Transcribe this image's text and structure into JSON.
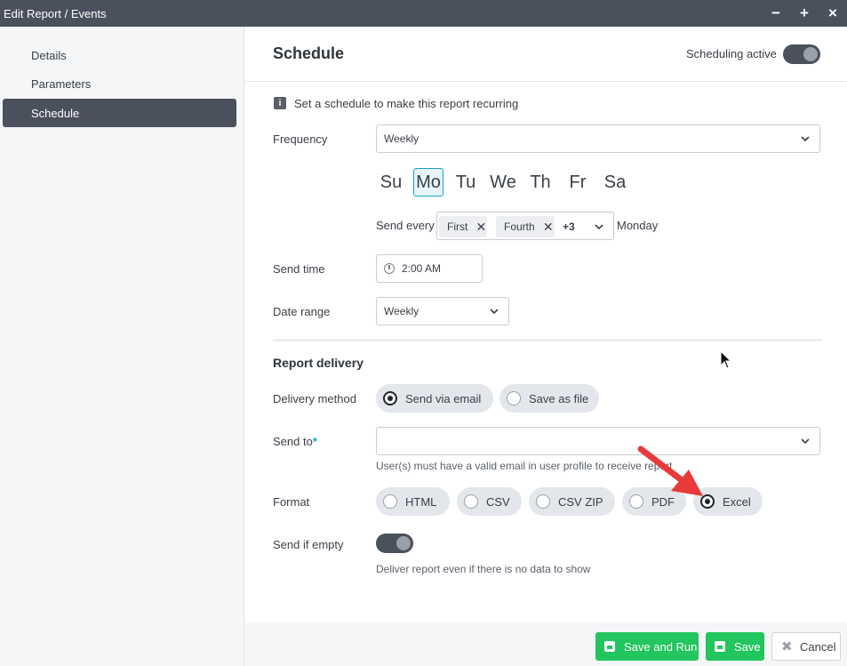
{
  "window": {
    "title": "Edit Report / Events",
    "minimize": "−",
    "maximize": "+",
    "close": "×"
  },
  "sidebar": {
    "items": [
      {
        "label": "Details"
      },
      {
        "label": "Parameters"
      },
      {
        "label": "Schedule"
      }
    ]
  },
  "header": {
    "title": "Schedule",
    "scheduling_label": "Scheduling active"
  },
  "schedule": {
    "info": "Set a schedule to make this report recurring",
    "frequency_label": "Frequency",
    "frequency_value": "Weekly",
    "days": [
      "Su",
      "Mo",
      "Tu",
      "We",
      "Th",
      "Fr",
      "Sa"
    ],
    "selected_day": "Mo",
    "send_every_label": "Send every",
    "send_every_chips": [
      "First",
      "Fourth"
    ],
    "send_every_more": "+3",
    "send_every_suffix": "Monday",
    "send_time_label": "Send time",
    "send_time_value": "2:00 AM",
    "date_range_label": "Date range",
    "date_range_value": "Weekly"
  },
  "delivery": {
    "title": "Report delivery",
    "method_label": "Delivery method",
    "methods": [
      "Send via email",
      "Save as file"
    ],
    "send_to_label": "Send to",
    "required_mark": "*",
    "send_to_help": "User(s) must have a valid email in user profile to receive report",
    "format_label": "Format",
    "formats": [
      "HTML",
      "CSV",
      "CSV ZIP",
      "PDF",
      "Excel"
    ],
    "selected_format": "Excel",
    "send_if_empty_label": "Send if empty",
    "send_if_empty_help": "Deliver report even if there is no data to show"
  },
  "footer": {
    "save_and_run": "Save and Run",
    "save": "Save",
    "cancel": "Cancel"
  },
  "colors": {
    "titlebar": "#4a505c",
    "accent": "#1aa0c8",
    "primary_button": "#22c55e",
    "annotation_arrow": "#e83a3a"
  }
}
